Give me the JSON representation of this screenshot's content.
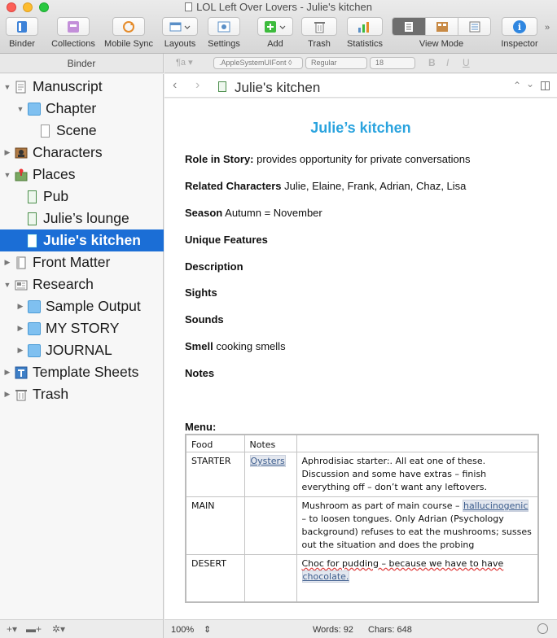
{
  "window": {
    "title": "LOL Left Over Lovers - Julie's kitchen"
  },
  "toolbar": {
    "binder": "Binder",
    "collections": "Collections",
    "mobile_sync": "Mobile Sync",
    "layouts": "Layouts",
    "settings": "Settings",
    "add": "Add",
    "trash": "Trash",
    "statistics": "Statistics",
    "view_mode": "View Mode",
    "inspector": "Inspector"
  },
  "binder_header": "Binder",
  "format_bar": {
    "font": ".AppleSystemUIFont",
    "style": "Regular",
    "size": "18",
    "bold": "B",
    "italic": "I",
    "underline": "U"
  },
  "binder_items": [
    {
      "label": "Manuscript"
    },
    {
      "label": "Chapter"
    },
    {
      "label": "Scene"
    },
    {
      "label": "Characters"
    },
    {
      "label": "Places"
    },
    {
      "label": "Pub"
    },
    {
      "label": "Julie’s lounge"
    },
    {
      "label": "Julie's kitchen"
    },
    {
      "label": "Front Matter"
    },
    {
      "label": "Research"
    },
    {
      "label": "Sample Output"
    },
    {
      "label": "MY STORY"
    },
    {
      "label": "JOURNAL"
    },
    {
      "label": "Template Sheets"
    },
    {
      "label": "Trash"
    }
  ],
  "editor_header": {
    "title": "Julie's kitchen"
  },
  "document": {
    "title": "Julie’s kitchen",
    "fields": [
      {
        "label": "Role in Story:",
        "value": "provides opportunity for private conversations"
      },
      {
        "label": "Related Characters",
        "value": "Julie, Elaine, Frank, Adrian, Chaz, Lisa"
      },
      {
        "label": "Season",
        "value": "Autumn = November"
      },
      {
        "label": "Unique Features",
        "value": ""
      },
      {
        "label": "Description",
        "value": ""
      },
      {
        "label": "Sights",
        "value": ""
      },
      {
        "label": "Sounds",
        "value": ""
      },
      {
        "label": "Smell",
        "value": "cooking smells"
      },
      {
        "label": "Notes",
        "value": ""
      }
    ],
    "menu_label": "Menu:",
    "menu_headers": [
      "Food",
      "Notes"
    ],
    "menu_rows": [
      {
        "food": "STARTER",
        "link": "Oysters",
        "notes_pre": "Aphrodisiac starter:. All eat one of these. Discussion and some have extras – finish everything off – don’t want any leftovers.",
        "notes_link": "",
        "notes_post": ""
      },
      {
        "food": "MAIN",
        "link": "",
        "notes_pre": "Mushroom as part of main course – ",
        "notes_link": "hallucinogenic",
        "notes_post": " – to loosen tongues. Only Adrian (Psychology background) refuses to eat the mushrooms; susses out the situation and does the probing"
      },
      {
        "food": "DESERT",
        "link": "",
        "notes_pre": "Choc for pudding – because we have to have ",
        "notes_link": "chocolate.",
        "notes_post": ""
      }
    ]
  },
  "status": {
    "zoom": "100%",
    "words": "Words: 92",
    "chars": "Chars: 648"
  }
}
